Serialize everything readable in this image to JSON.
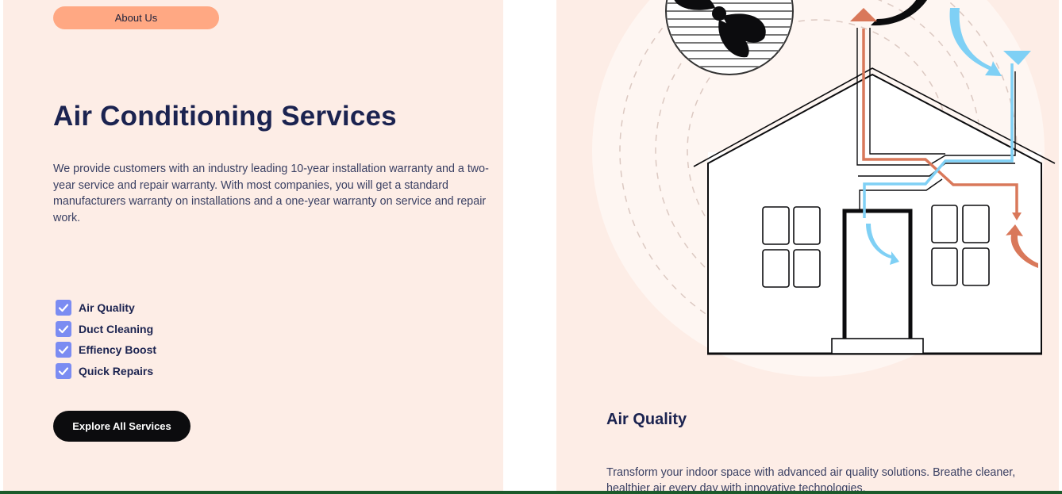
{
  "left": {
    "about_button": "About Us",
    "title": "Air Conditioning Services",
    "description": "We provide customers with an industry leading 10-year installation warranty and a two-year service and repair warranty. With most companies, you will get a standard manufacturers warranty on installations and a one-year warranty on service and repair work.",
    "features": [
      "Air Quality",
      "Duct Cleaning",
      "Effiency Boost",
      "Quick Repairs"
    ],
    "cta": "Explore All Services"
  },
  "right": {
    "feature_title": "Air Quality",
    "feature_description": "Transform your indoor space with advanced air quality solutions. Breathe cleaner, healthier air every day with innovative technologies."
  },
  "colors": {
    "panel_bg": "#fdede6",
    "accent_orange": "#ffa883",
    "navy": "#1b2350",
    "check_blue": "#7b8cf2",
    "airflow_blue": "#7fd0f5",
    "airflow_red": "#d9785a"
  }
}
